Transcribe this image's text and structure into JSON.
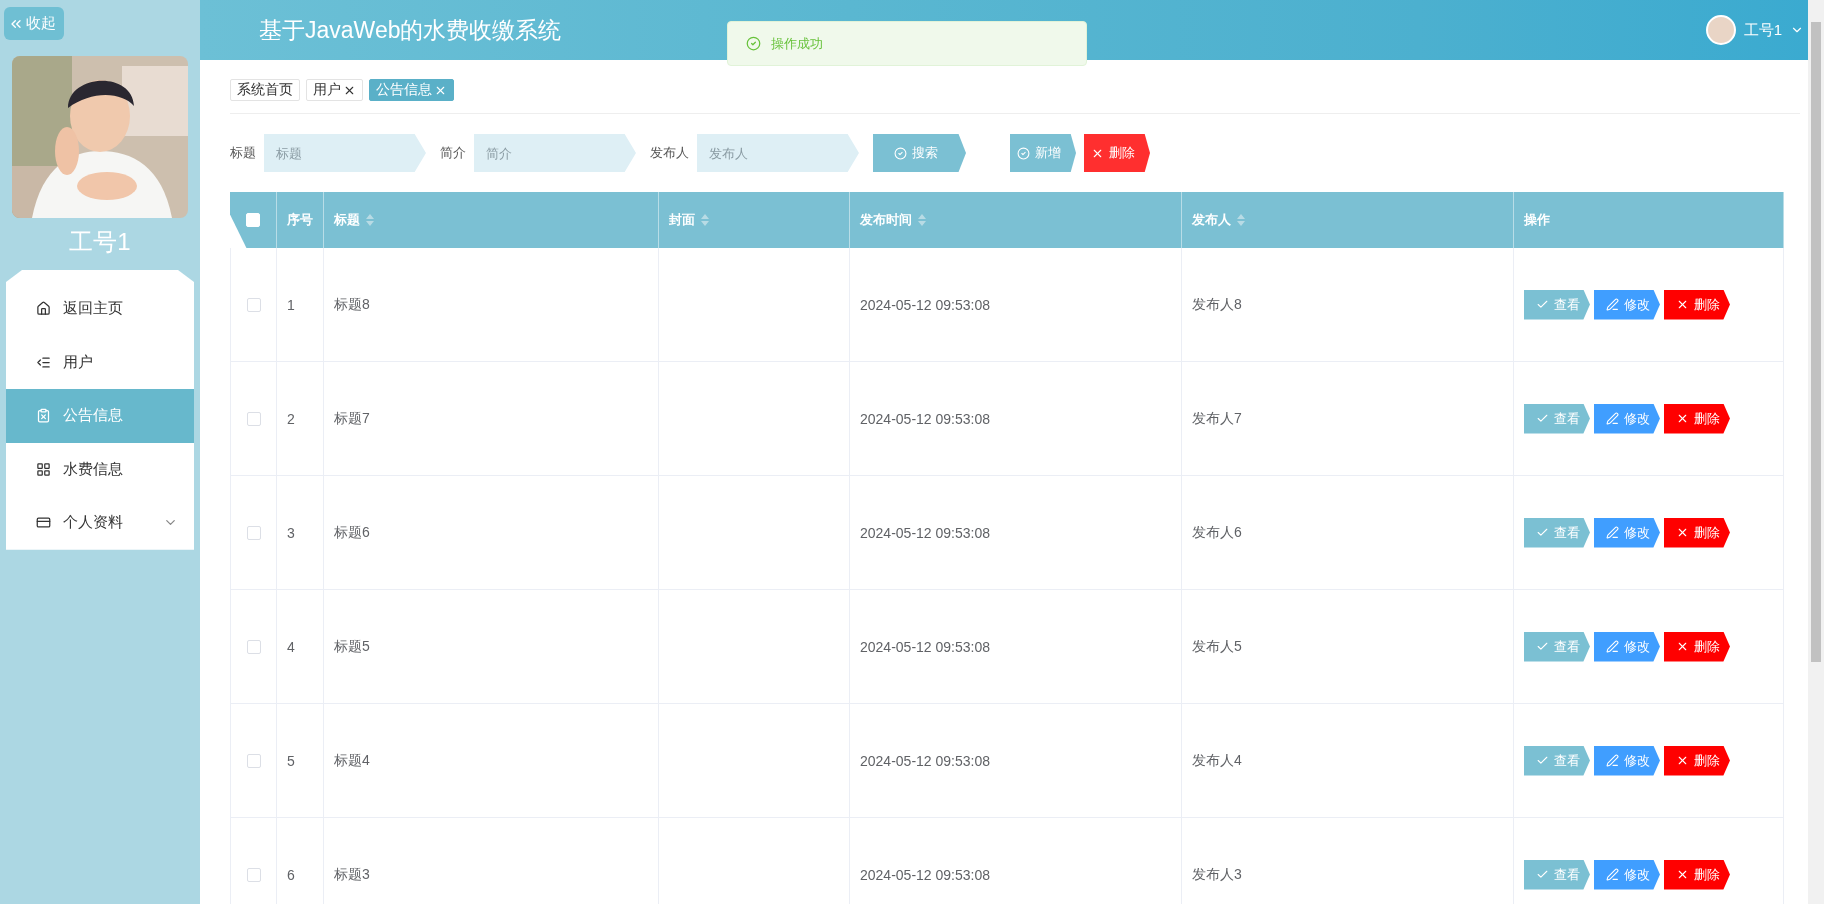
{
  "sidebar": {
    "collapse_button": "收起",
    "profile": {
      "name": "工号1"
    },
    "menu": [
      {
        "label": "返回主页",
        "selected": false,
        "kind": "link"
      },
      {
        "label": "用户",
        "selected": false,
        "kind": "link"
      },
      {
        "label": "公告信息",
        "selected": true,
        "kind": "link"
      },
      {
        "label": "水费信息",
        "selected": false,
        "kind": "link"
      },
      {
        "label": "个人资料",
        "selected": false,
        "kind": "submenu"
      }
    ]
  },
  "header": {
    "title": "基于JavaWeb的水费收缴系统",
    "user": {
      "name": "工号1"
    }
  },
  "toast": {
    "message": "操作成功"
  },
  "tabs": [
    {
      "label": "系统首页",
      "selected": false,
      "closable": false
    },
    {
      "label": "用户",
      "selected": false,
      "closable": true
    },
    {
      "label": "公告信息",
      "selected": true,
      "closable": true
    }
  ],
  "search": {
    "fields": [
      {
        "label": "标题",
        "placeholder": "标题"
      },
      {
        "label": "简介",
        "placeholder": "简介"
      },
      {
        "label": "发布人",
        "placeholder": "发布人"
      }
    ],
    "buttons": [
      {
        "kind": "search",
        "label": "搜索"
      },
      {
        "kind": "add",
        "label": "新增"
      },
      {
        "kind": "delete",
        "label": "删除"
      }
    ]
  },
  "table": {
    "select_all": {
      "checked": false
    },
    "columns": [
      {
        "label": "序号",
        "sortable": false
      },
      {
        "label": "标题",
        "sortable": true
      },
      {
        "label": "封面",
        "sortable": true
      },
      {
        "label": "发布时间",
        "sortable": true
      },
      {
        "label": "发布人",
        "sortable": true
      },
      {
        "label": "操作",
        "sortable": false
      }
    ],
    "rows": [
      {
        "checked": false,
        "index": "1",
        "title": "标题8",
        "time": "2024-05-12 09:53:08",
        "publisher": "发布人8",
        "actions": [
          {
            "kind": "view",
            "label": "查看"
          },
          {
            "kind": "edit",
            "label": "修改"
          },
          {
            "kind": "delete",
            "label": "删除"
          }
        ]
      },
      {
        "checked": false,
        "index": "2",
        "title": "标题7",
        "time": "2024-05-12 09:53:08",
        "publisher": "发布人7",
        "actions": [
          {
            "kind": "view",
            "label": "查看"
          },
          {
            "kind": "edit",
            "label": "修改"
          },
          {
            "kind": "delete",
            "label": "删除"
          }
        ]
      },
      {
        "checked": false,
        "index": "3",
        "title": "标题6",
        "time": "2024-05-12 09:53:08",
        "publisher": "发布人6",
        "actions": [
          {
            "kind": "view",
            "label": "查看"
          },
          {
            "kind": "edit",
            "label": "修改"
          },
          {
            "kind": "delete",
            "label": "删除"
          }
        ]
      },
      {
        "checked": false,
        "index": "4",
        "title": "标题5",
        "time": "2024-05-12 09:53:08",
        "publisher": "发布人5",
        "actions": [
          {
            "kind": "view",
            "label": "查看"
          },
          {
            "kind": "edit",
            "label": "修改"
          },
          {
            "kind": "delete",
            "label": "删除"
          }
        ]
      },
      {
        "checked": false,
        "index": "5",
        "title": "标题4",
        "time": "2024-05-12 09:53:08",
        "publisher": "发布人4",
        "actions": [
          {
            "kind": "view",
            "label": "查看"
          },
          {
            "kind": "edit",
            "label": "修改"
          },
          {
            "kind": "delete",
            "label": "删除"
          }
        ]
      },
      {
        "checked": false,
        "index": "6",
        "title": "标题3",
        "time": "2024-05-12 09:53:08",
        "publisher": "发布人3",
        "actions": [
          {
            "kind": "view",
            "label": "查看"
          },
          {
            "kind": "edit",
            "label": "修改"
          },
          {
            "kind": "delete",
            "label": "删除"
          }
        ]
      }
    ]
  }
}
